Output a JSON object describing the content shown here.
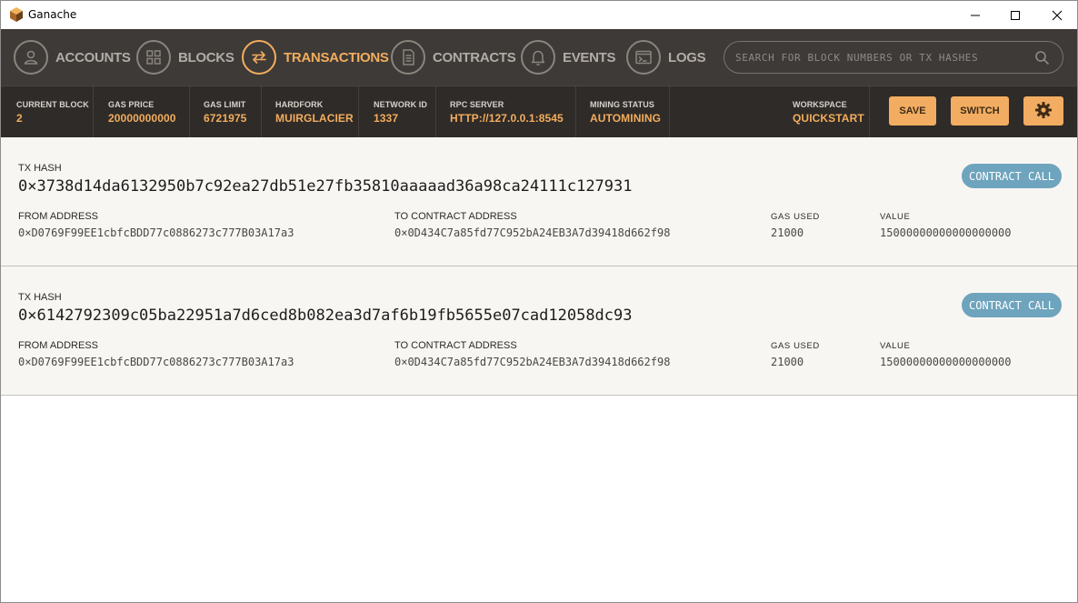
{
  "window": {
    "title": "Ganache"
  },
  "nav": {
    "items": [
      {
        "label": "ACCOUNTS",
        "icon": "account-icon",
        "active": false
      },
      {
        "label": "BLOCKS",
        "icon": "blocks-icon",
        "active": false
      },
      {
        "label": "TRANSACTIONS",
        "icon": "transactions-icon",
        "active": true
      },
      {
        "label": "CONTRACTS",
        "icon": "contracts-icon",
        "active": false
      },
      {
        "label": "EVENTS",
        "icon": "bell-icon",
        "active": false
      },
      {
        "label": "LOGS",
        "icon": "terminal-icon",
        "active": false
      }
    ],
    "search_placeholder": "SEARCH FOR BLOCK NUMBERS OR TX HASHES"
  },
  "status": {
    "items": [
      {
        "label": "CURRENT BLOCK",
        "value": "2"
      },
      {
        "label": "GAS PRICE",
        "value": "20000000000"
      },
      {
        "label": "GAS LIMIT",
        "value": "6721975"
      },
      {
        "label": "HARDFORK",
        "value": "MUIRGLACIER"
      },
      {
        "label": "NETWORK ID",
        "value": "1337"
      },
      {
        "label": "RPC SERVER",
        "value": "HTTP://127.0.0.1:8545"
      },
      {
        "label": "MINING STATUS",
        "value": "AUTOMINING"
      }
    ],
    "workspace_label": "WORKSPACE",
    "workspace_value": "QUICKSTART",
    "save_label": "SAVE",
    "switch_label": "SWITCH"
  },
  "transactions": [
    {
      "hash_label": "TX HASH",
      "hash": "0×3738d14da6132950b7c92ea27db51e27fb35810aaaaad36a98ca24111c127931",
      "badge": "CONTRACT CALL",
      "from_label": "FROM ADDRESS",
      "from": "0×D0769F99EE1cbfcBDD77c0886273c777B03A17a3",
      "to_label": "TO CONTRACT ADDRESS",
      "to": "0×0D434C7a85fd77C952bA24EB3A7d39418d662f98",
      "gas_label": "GAS USED",
      "gas": "21000",
      "value_label": "VALUE",
      "value": "15000000000000000000"
    },
    {
      "hash_label": "TX HASH",
      "hash": "0×6142792309c05ba22951a7d6ced8b082ea3d7af6b19fb5655e07cad12058dc93",
      "badge": "CONTRACT CALL",
      "from_label": "FROM ADDRESS",
      "from": "0×D0769F99EE1cbfcBDD77c0886273c777B03A17a3",
      "to_label": "TO CONTRACT ADDRESS",
      "to": "0×0D434C7a85fd77C952bA24EB3A7d39418d662f98",
      "gas_label": "GAS USED",
      "gas": "21000",
      "value_label": "VALUE",
      "value": "15000000000000000000"
    }
  ]
}
